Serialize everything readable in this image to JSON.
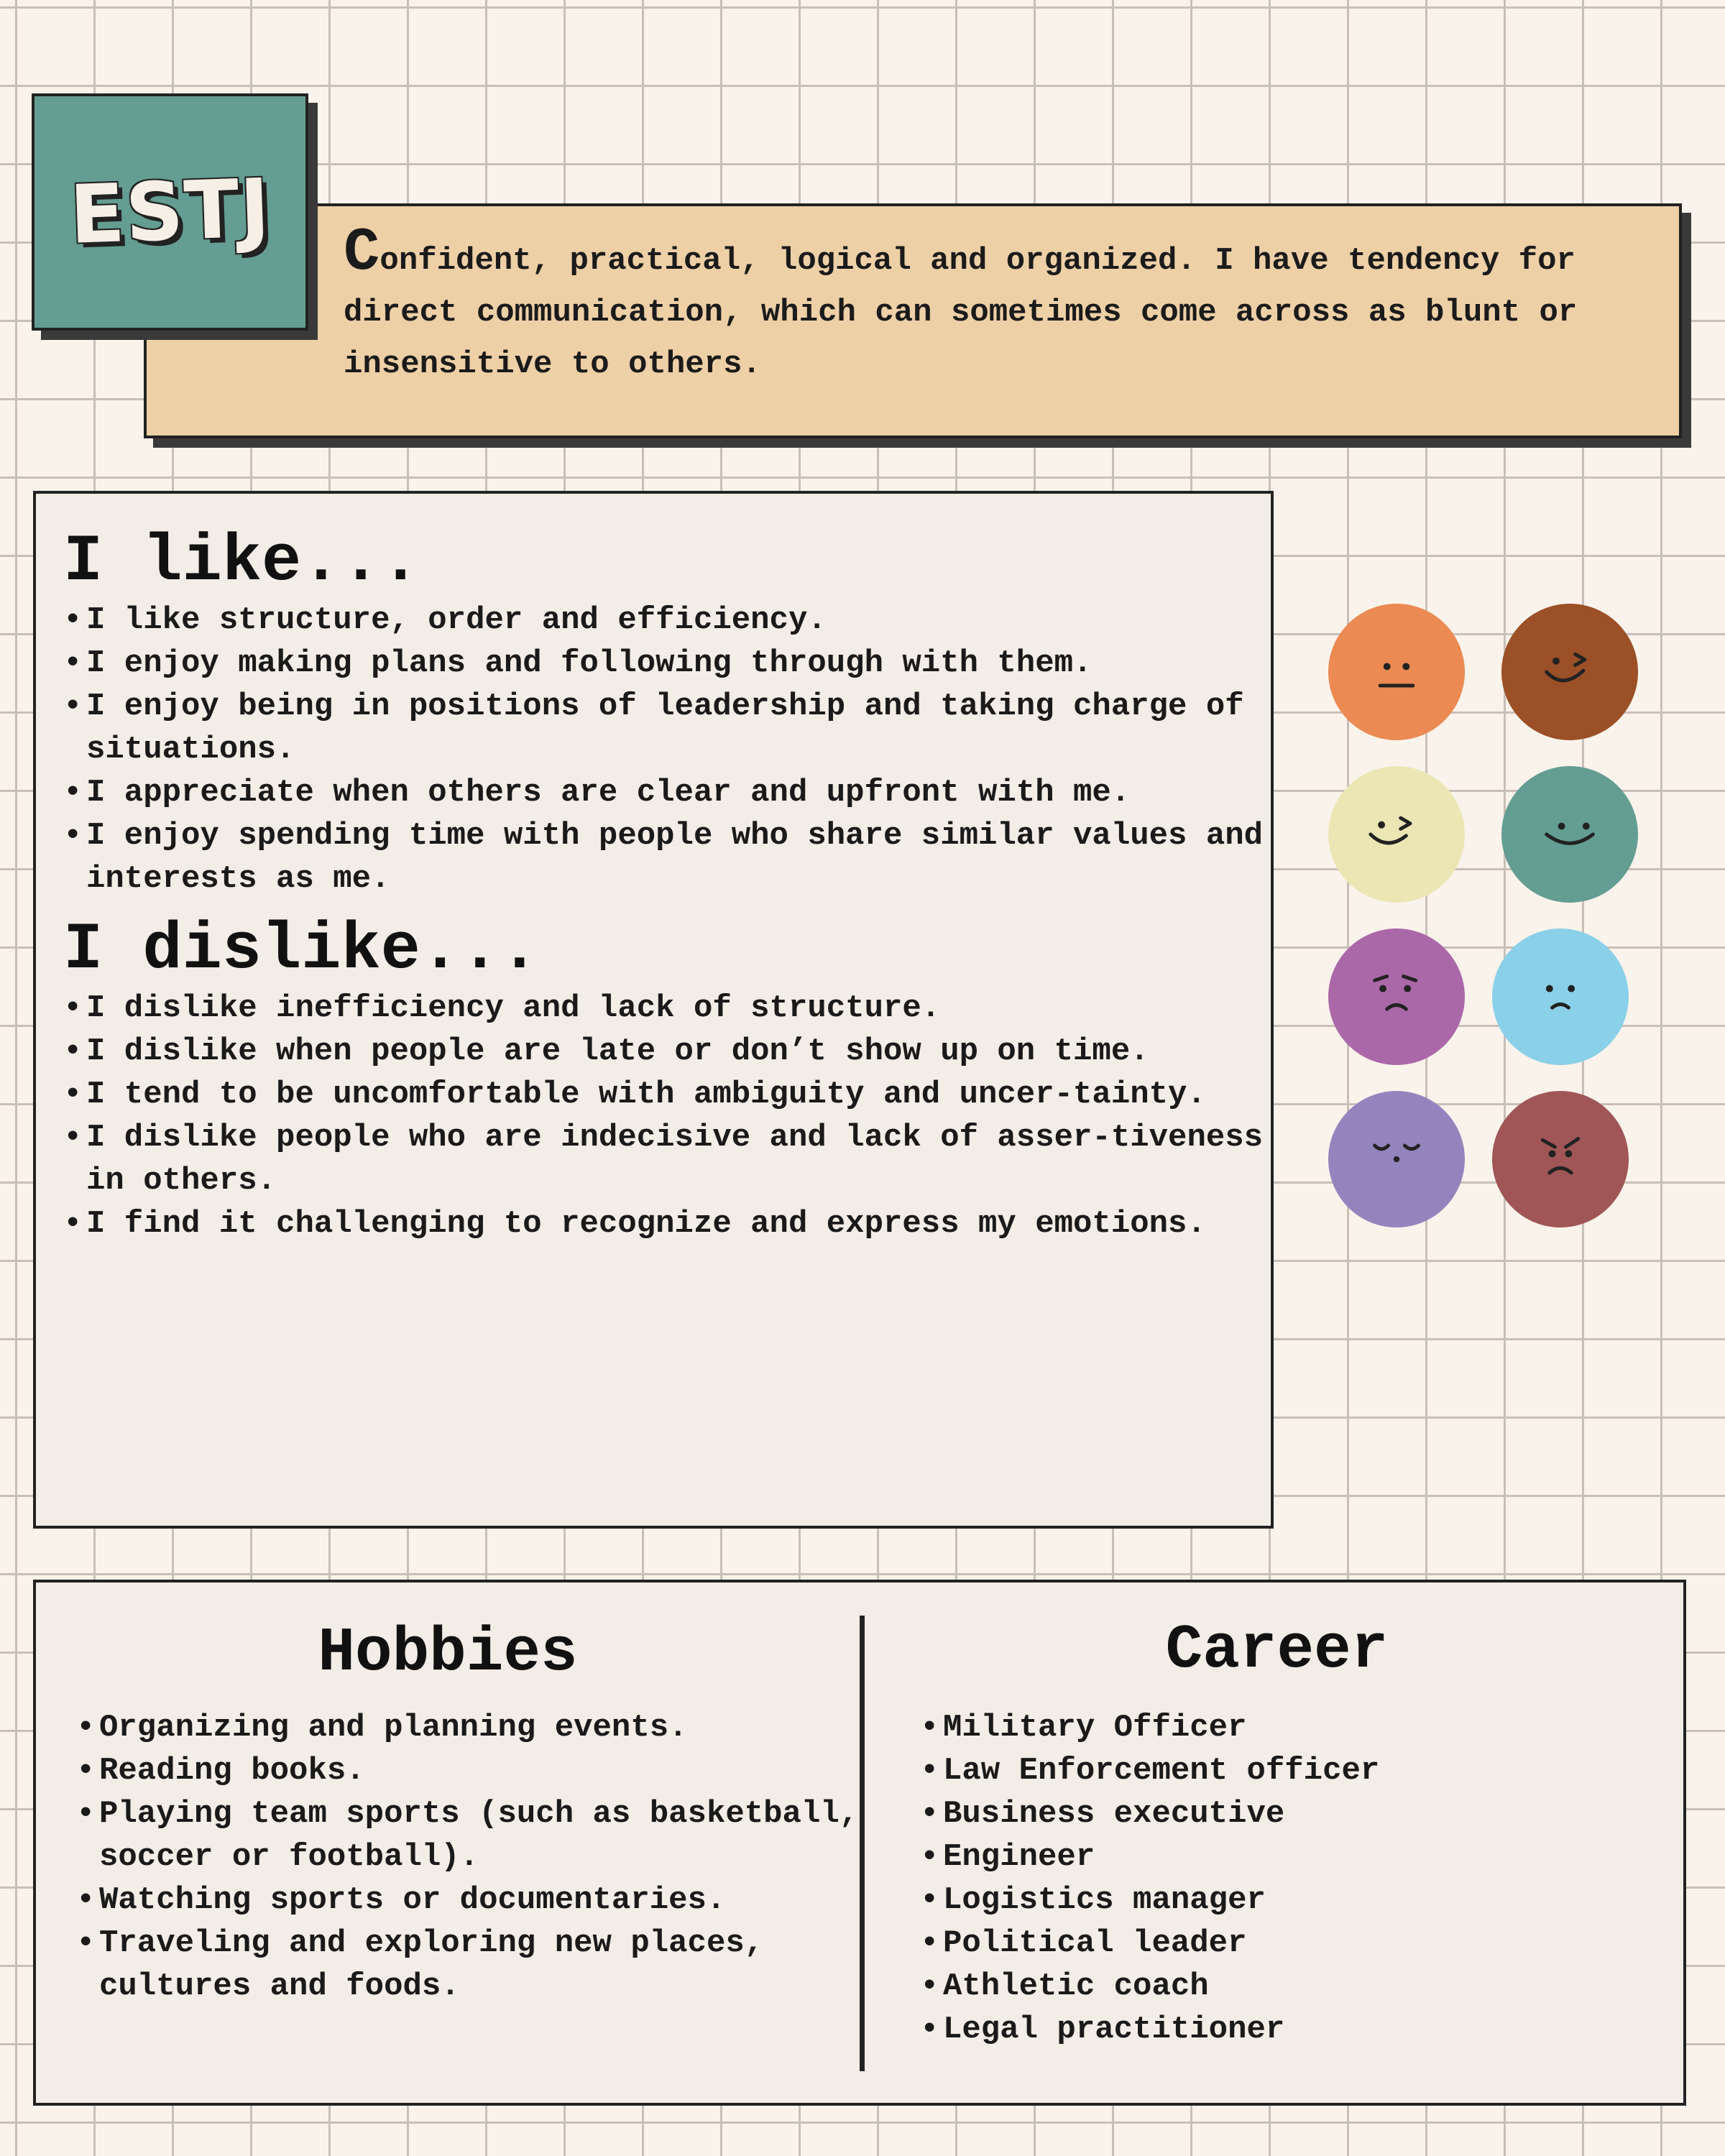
{
  "badge": {
    "title": "ESTJ"
  },
  "summary": {
    "text": "Confident, practical, logical and organized. I have tendency for direct communication, which can sometimes come across as blunt or insensitive to others."
  },
  "likes": {
    "title": "I like...",
    "items": [
      "I like structure, order and efficiency.",
      "I enjoy making plans and following through with them.",
      "I enjoy being in positions of leadership and taking charge of situations.",
      "I appreciate when others are clear and upfront with me.",
      "I enjoy spending time with people who share similar values and interests as me."
    ]
  },
  "dislikes": {
    "title": "I dislike...",
    "items": [
      "I dislike inefficiency and lack of structure.",
      "I dislike when people are late or don’t show up on time.",
      "I tend to be uncomfortable with ambiguity and uncer-tainty.",
      "I dislike people who are indecisive and lack of asser-tiveness in others.",
      "I find it challenging to recognize and express my emotions."
    ]
  },
  "faces": [
    {
      "icon": "neutral-face-icon",
      "color": "#eb8a52"
    },
    {
      "icon": "winking-face-icon",
      "color": "#9c5027"
    },
    {
      "icon": "winking-smile-face-icon",
      "color": "#ebe6b4"
    },
    {
      "icon": "smiling-face-icon",
      "color": "#649d91"
    },
    {
      "icon": "worried-face-icon",
      "color": "#ab68a8"
    },
    {
      "icon": "sad-face-icon",
      "color": "#8ad0e8"
    },
    {
      "icon": "sleepy-face-icon",
      "color": "#9484bd"
    },
    {
      "icon": "angry-face-icon",
      "color": "#a05656"
    }
  ],
  "hobbies": {
    "title": "Hobbies",
    "items": [
      "Organizing and planning events.",
      "Reading books.",
      "Playing team sports (such as basketball, soccer or football).",
      "Watching sports or documentaries.",
      "Traveling and exploring new places, cultures and foods."
    ]
  },
  "career": {
    "title": "Career",
    "items": [
      "Military Officer",
      "Law Enforcement officer",
      "Business executive",
      "Engineer",
      "Logistics manager",
      "Political leader",
      "Athletic coach",
      "Legal practitioner"
    ]
  }
}
